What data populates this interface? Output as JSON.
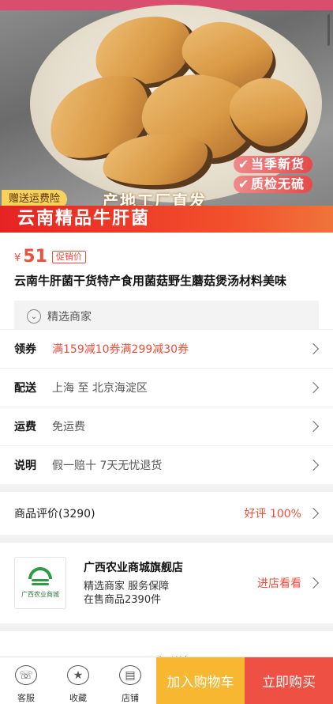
{
  "hero": {
    "badges": [
      "当季新货",
      "质检无硫"
    ],
    "gift_tag": "赠送运费险",
    "slogan": "产地工厂直发",
    "banner_title": "云南精品牛肝菌"
  },
  "product": {
    "currency": "¥",
    "price": "51",
    "promo_tag": "促销价",
    "title": "云南牛肝菌干货特产食用菌菇野生蘑菇煲汤材料美味",
    "merchant_tag": "精选商家"
  },
  "rows": [
    {
      "label": "领券",
      "value": "满159减10券满299减30券",
      "highlight": true
    },
    {
      "label": "配送",
      "value": "上海 至 北京海淀区",
      "highlight": false
    },
    {
      "label": "运费",
      "value": "免运费",
      "highlight": false
    },
    {
      "label": "说明",
      "value": "假一赔十 7天无忧退货",
      "highlight": false
    }
  ],
  "review": {
    "label": "商品评价(3290)",
    "good_rate": "好评 100%"
  },
  "shop": {
    "logo_text": "广西农业商城",
    "name": "广西农业商城旗舰店",
    "line1": "精选商家 服务保障",
    "line2": "在售商品2390件",
    "enter_label": "进店看看"
  },
  "detail": {
    "heading": "图文详情"
  },
  "bottom_bar": {
    "tools": [
      {
        "label": "客服",
        "icon": "customer-service-icon"
      },
      {
        "label": "收藏",
        "icon": "star-icon"
      },
      {
        "label": "店铺",
        "icon": "store-icon"
      }
    ],
    "cart_label": "加入购物车",
    "buy_label": "立即购买"
  },
  "colors": {
    "accent": "#ef4e3a",
    "cart": "#f7b731",
    "buy": "#ee5143"
  }
}
